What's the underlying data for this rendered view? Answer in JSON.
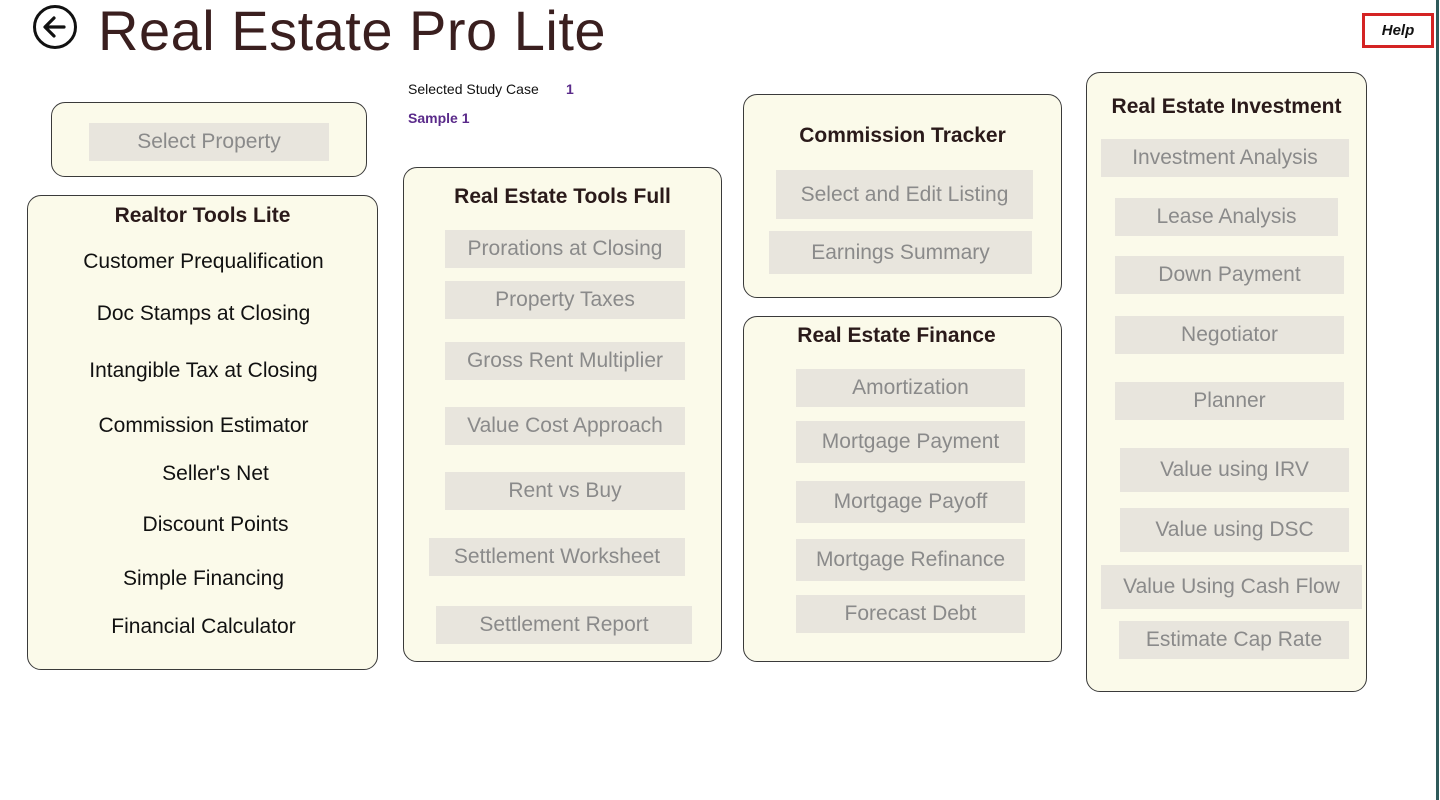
{
  "header": {
    "title": "Real Estate Pro Lite",
    "help_label": "Help"
  },
  "study": {
    "label": "Selected Study Case",
    "number": "1",
    "name": "Sample 1"
  },
  "select_property": {
    "label": "Select Property"
  },
  "realtor_tools_lite": {
    "title": "Realtor Tools Lite",
    "items": [
      "Customer Prequalification",
      "Doc Stamps at Closing",
      "Intangible Tax at Closing",
      "Commission Estimator",
      "Seller's Net",
      "Discount Points",
      "Simple Financing",
      "Financial Calculator"
    ]
  },
  "real_estate_tools_full": {
    "title": "Real Estate  Tools Full",
    "items": [
      "Prorations at Closing",
      "Property Taxes",
      "Gross Rent Multiplier",
      "Value Cost Approach",
      "Rent vs Buy",
      "Settlement Worksheet",
      "Settlement Report"
    ]
  },
  "commission_tracker": {
    "title": "Commission Tracker",
    "items": [
      "Select and Edit Listing",
      "Earnings Summary"
    ]
  },
  "real_estate_finance": {
    "title": "Real Estate Finance",
    "items": [
      "Amortization",
      "Mortgage Payment",
      "Mortgage Payoff",
      "Mortgage Refinance",
      "Forecast Debt"
    ]
  },
  "real_estate_investment": {
    "title": "Real Estate Investment",
    "items": [
      "Investment Analysis",
      "Lease Analysis",
      "Down Payment",
      "Negotiator",
      "Planner",
      "Value using IRV",
      "Value using DSC",
      "Value Using Cash Flow",
      "Estimate Cap Rate"
    ]
  },
  "colors": {
    "panel_bg": "#fbfaea",
    "button_bg": "#e8e5dd",
    "button_text": "#8a8a8a",
    "title_text": "#3a1f1f",
    "accent_purple": "#5a2a8a",
    "help_border": "#d42323"
  },
  "icons": {
    "back": "back-arrow-icon"
  }
}
